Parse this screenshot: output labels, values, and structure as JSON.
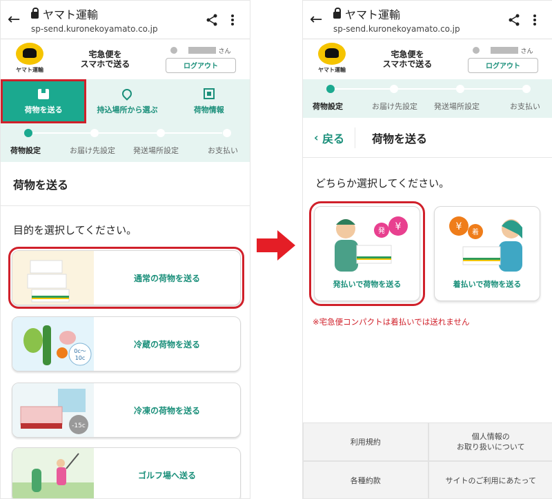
{
  "browser": {
    "title": "ヤマト運輸",
    "url": "sp-send.kuronekoyamato.co.jp"
  },
  "site": {
    "logo_text": "ヤマト運輸",
    "tagline_line1": "宅急便を",
    "tagline_line2": "スマホで送る",
    "user_suffix": "さん",
    "logout_label": "ログアウト"
  },
  "tabs": [
    {
      "label": "荷物を送る",
      "icon": "box-icon"
    },
    {
      "label": "持込場所から選ぶ",
      "icon": "map-pin-icon"
    },
    {
      "label": "荷物情報",
      "icon": "qr-code-icon"
    }
  ],
  "steps": [
    "荷物設定",
    "お届け先設定",
    "発送場所設定",
    "お支払い"
  ],
  "left": {
    "section_title": "荷物を送る",
    "prompt": "目的を選択してください。",
    "options": [
      {
        "label": "通常の荷物を送る"
      },
      {
        "label": "冷蔵の荷物を送る",
        "badge_line1": "0c〜",
        "badge_line2": "10c"
      },
      {
        "label": "冷凍の荷物を送る",
        "badge": "-15c"
      },
      {
        "label": "ゴルフ場へ送る"
      }
    ]
  },
  "right": {
    "back_label": "戻る",
    "title": "荷物を送る",
    "prompt": "どちらか選択してください。",
    "cards": [
      {
        "label": "発払いで荷物を送る",
        "badge1": "発",
        "badge2": "¥"
      },
      {
        "label": "着払いで荷物を送る",
        "badge1": "¥",
        "badge2": "着"
      }
    ],
    "note": "※宅急便コンパクトは着払いでは送れません",
    "footer": [
      [
        "利用規約",
        "個人情報の\nお取り扱いについて"
      ],
      [
        "各種約款",
        "サイトのご利用にあたって"
      ]
    ]
  },
  "colors": {
    "accent": "#1ba98f",
    "accent_text": "#1a8f7a",
    "highlight": "#d0202a",
    "tab_bg": "#e6f4f1"
  }
}
